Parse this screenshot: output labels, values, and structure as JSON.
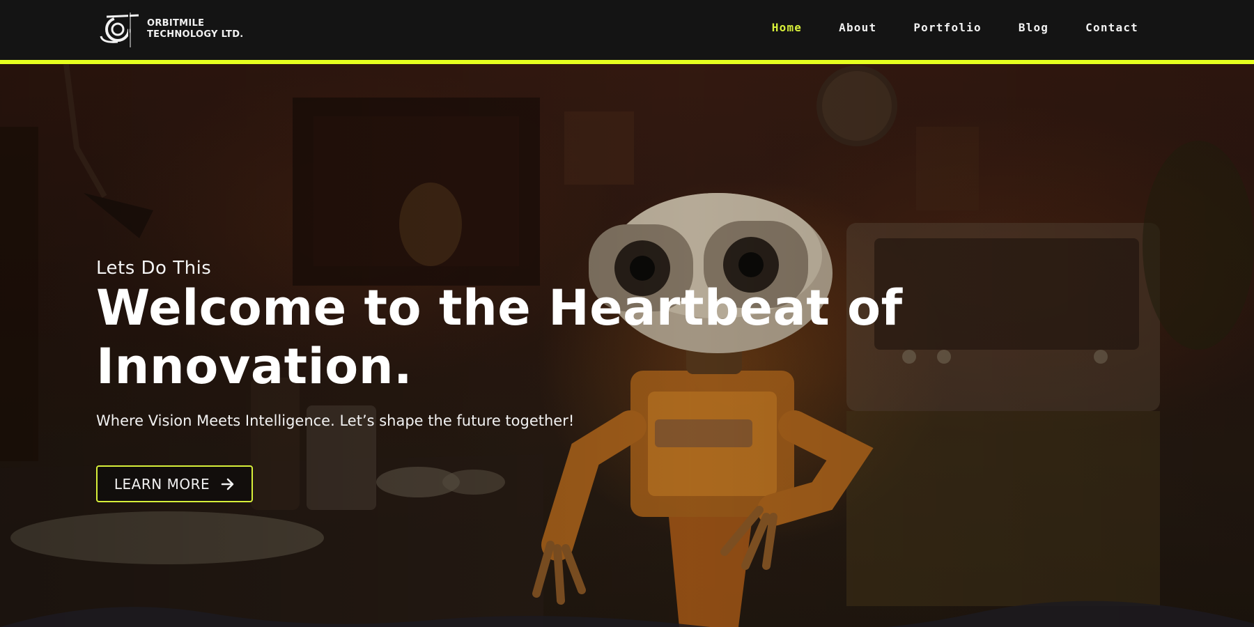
{
  "header": {
    "logo": {
      "icon": "orbit-logo-icon",
      "line1": "ORBITMILE",
      "line2": "TECHNOLOGY LTD."
    },
    "nav": [
      {
        "label": "Home",
        "active": true
      },
      {
        "label": "About",
        "active": false
      },
      {
        "label": "Portfolio",
        "active": false
      },
      {
        "label": "Blog",
        "active": false
      },
      {
        "label": "Contact",
        "active": false
      }
    ]
  },
  "hero": {
    "eyebrow": "Lets Do This",
    "headline": "Welcome to the Heartbeat of Innovation.",
    "subtitle": "Where Vision Meets Intelligence. Let’s shape the future together!",
    "cta": {
      "label": "LEARN MORE",
      "icon": "arrow-right-icon"
    },
    "background": "robot-in-kitchen-photo"
  },
  "colors": {
    "accent": "#e6ff1f",
    "nav_active": "#d8f03a",
    "header_bg": "#141414",
    "text": "#ffffff"
  }
}
